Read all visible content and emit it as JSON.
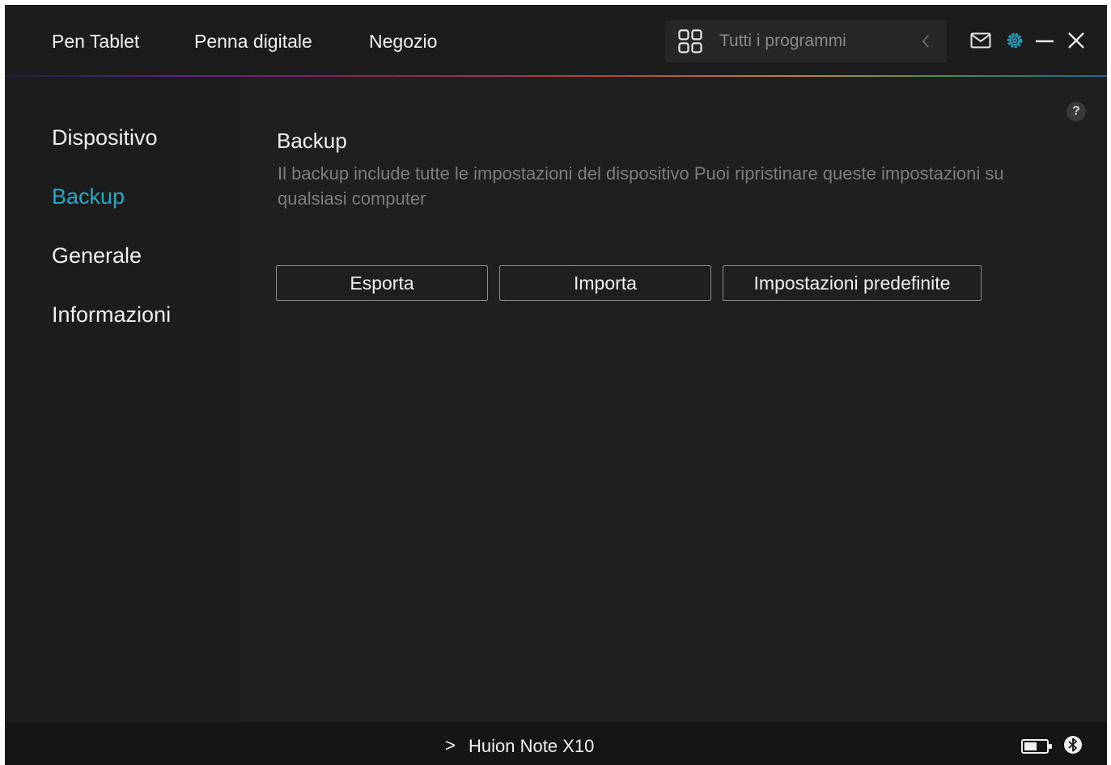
{
  "topbar": {
    "nav": [
      "Pen Tablet",
      "Penna digitale",
      "Negozio"
    ],
    "programs_label": "Tutti i programmi",
    "icons": {
      "programs": "grid-icon",
      "back": "chevron-left-icon",
      "mail": "mail-icon",
      "settings": "gear-icon",
      "minimize": "minimize-icon",
      "close": "close-icon"
    },
    "accent_color": "#27a8c6"
  },
  "sidebar": {
    "items": [
      {
        "label": "Dispositivo",
        "active": false
      },
      {
        "label": "Backup",
        "active": true
      },
      {
        "label": "Generale",
        "active": false
      },
      {
        "label": "Informazioni",
        "active": false
      }
    ]
  },
  "main": {
    "help_label": "?",
    "title": "Backup",
    "description": "Il backup include tutte le impostazioni del dispositivo Puoi ripristinare queste impostazioni su qualsiasi computer",
    "buttons": {
      "export": "Esporta",
      "import": "Importa",
      "defaults": "Impostazioni predefinite"
    }
  },
  "bottombar": {
    "chevron": ">",
    "device": "Huion Note X10",
    "icons": {
      "battery": "battery-icon",
      "bluetooth": "bluetooth-icon"
    }
  }
}
